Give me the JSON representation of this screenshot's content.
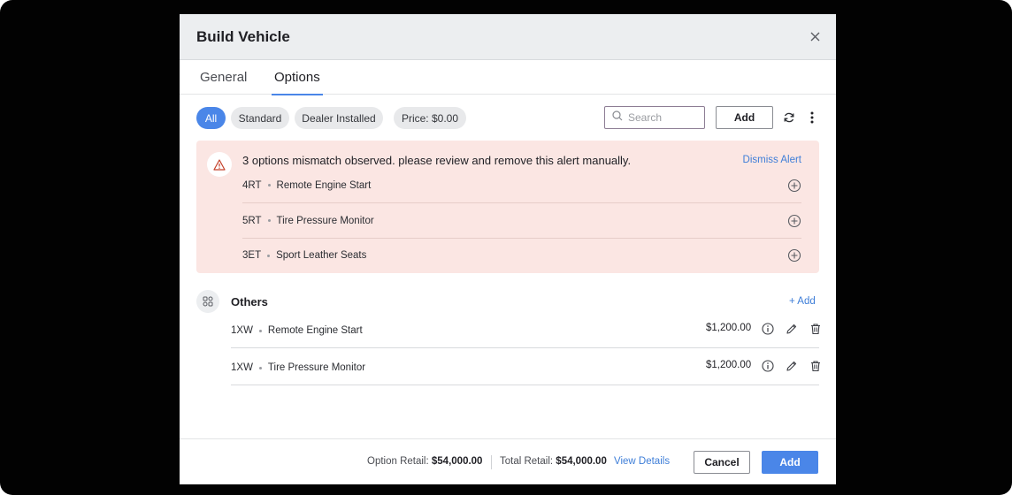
{
  "modal": {
    "title": "Build Vehicle"
  },
  "tabs": [
    {
      "label": "General",
      "active": false
    },
    {
      "label": "Options",
      "active": true
    }
  ],
  "filters": {
    "chips": [
      "All",
      "Standard",
      "Dealer Installed",
      "Price: $0.00"
    ],
    "selected": "All"
  },
  "search": {
    "placeholder": "Search",
    "value": ""
  },
  "toolbar": {
    "add_label": "Add",
    "refresh_icon": "refresh-icon",
    "more_icon": "kebab-icon"
  },
  "alert": {
    "icon": "warning-icon",
    "message": "3 options mismatch observed. please review and remove this alert manually.",
    "dismiss_label": "Dismiss Alert",
    "items": [
      {
        "code": "4RT",
        "name": "Remote Engine Start"
      },
      {
        "code": "5RT",
        "name": "Tire Pressure Monitor"
      },
      {
        "code": "3ET",
        "name": "Sport Leather Seats"
      }
    ]
  },
  "others": {
    "title": "Others",
    "add_label": "+ Add",
    "items": [
      {
        "code": "1XW",
        "name": "Remote Engine Start",
        "price": "$1,200.00"
      },
      {
        "code": "1XW",
        "name": "Tire Pressure Monitor",
        "price": "$1,200.00"
      }
    ]
  },
  "footer": {
    "option_retail_label": "Option Retail:",
    "option_retail_value": "$54,000.00",
    "total_retail_label": "Total Retail:",
    "total_retail_value": "$54,000.00",
    "view_details_label": "View Details",
    "cancel_label": "Cancel",
    "add_label": "Add"
  },
  "colors": {
    "accent": "#4a86e8",
    "alert_bg": "#fbe6e3",
    "link": "#3e7ed8"
  }
}
